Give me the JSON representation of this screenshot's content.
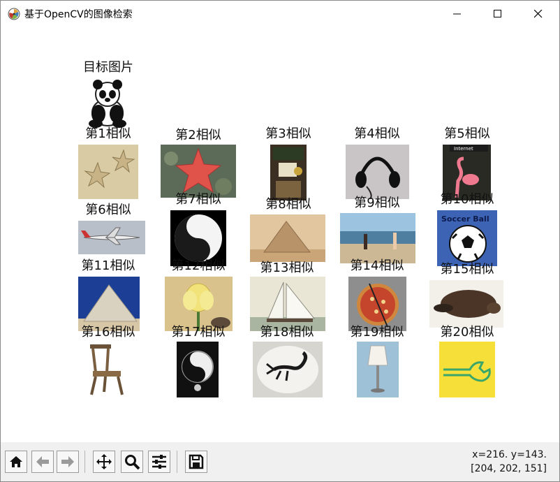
{
  "window": {
    "title": "基于OpenCV的图像检索",
    "icon": "matplotlib-icon",
    "controls": [
      "minimize-icon",
      "maximize-icon",
      "close-icon"
    ]
  },
  "figure": {
    "target_label": "目标图片",
    "target_image": "panda",
    "results": [
      {
        "label": "第1相似",
        "image": "starfish-sand"
      },
      {
        "label": "第2相似",
        "image": "red-starfish"
      },
      {
        "label": "第3相似",
        "image": "lamp-clock"
      },
      {
        "label": "第4相似",
        "image": "headphones"
      },
      {
        "label": "第5相似",
        "image": "flamingo"
      },
      {
        "label": "第6相似",
        "image": "airplane"
      },
      {
        "label": "第7相似",
        "image": "yin-yang"
      },
      {
        "label": "第8相似",
        "image": "pyramid"
      },
      {
        "label": "第9相似",
        "image": "beach-people"
      },
      {
        "label": "第10相似",
        "image": "soccer-ball"
      },
      {
        "label": "第11相似",
        "image": "pyramid-sky"
      },
      {
        "label": "第12相似",
        "image": "lotus-flower"
      },
      {
        "label": "第13相似",
        "image": "sailboat"
      },
      {
        "label": "第14相似",
        "image": "pizza"
      },
      {
        "label": "第15相似",
        "image": "platypus"
      },
      {
        "label": "第16相似",
        "image": "wooden-chair"
      },
      {
        "label": "第17相似",
        "image": "yin-yang-pendant"
      },
      {
        "label": "第18相似",
        "image": "scorpion"
      },
      {
        "label": "第19相似",
        "image": "table-lamp"
      },
      {
        "label": "第20相似",
        "image": "wrench-yellow"
      }
    ]
  },
  "toolbar": {
    "buttons": [
      "home-icon",
      "back-icon",
      "forward-icon",
      "pan-icon",
      "zoom-icon",
      "configure-subplots-icon",
      "save-icon"
    ]
  },
  "status": {
    "coords": "x=216. y=143.",
    "pixel": "[204, 202, 151]"
  }
}
